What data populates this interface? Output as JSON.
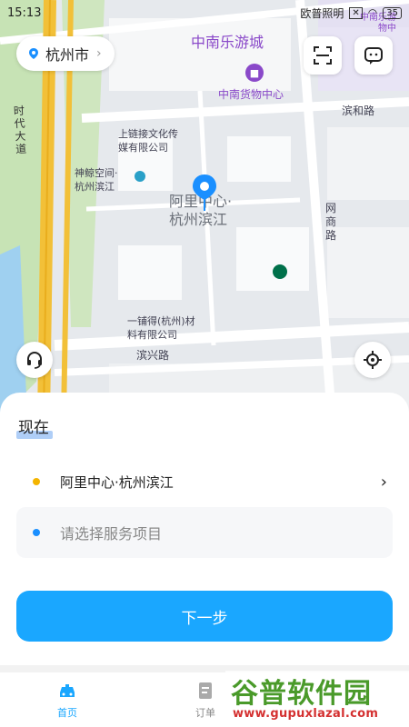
{
  "status_bar": {
    "time": "15:13",
    "carrier": "欧普照明",
    "battery": "35"
  },
  "map": {
    "labels": {
      "district_top": "中南乐游城",
      "mall": "中南货物中心",
      "road_binhe": "滨和路",
      "company1_line1": "上链接文化传",
      "company1_line2": "媒有限公司",
      "space_line1": "神鲸空间·",
      "space_line2": "杭州滨江",
      "current_line1": "阿里中心·",
      "current_line2": "杭州滨江",
      "road_wangshang": "网商路",
      "road_shidai": "时代大道",
      "company2_line1": "一铺得(杭州)材",
      "company2_line2": "料有限公司",
      "road_binxing": "滨兴路",
      "corner_top_right": "中南乐游",
      "corner_top_right2": "物中"
    },
    "colors": {
      "base": "#e9ecef",
      "block": "#f8f9fa",
      "road": "#ffffff",
      "highway": "#f2c038",
      "green": "#c7e3b5",
      "water": "#9fd0f0",
      "pin": "#1a8fff",
      "label_purple": "#8a49c9"
    }
  },
  "city_selector": {
    "label": "杭州市"
  },
  "panel": {
    "time_label": "现在",
    "from_location": "阿里中心·杭州滨江",
    "to_placeholder": "请选择服务项目",
    "next_button": "下一步",
    "from_dot_color": "#f4b400",
    "to_dot_color": "#1a8fff"
  },
  "tabs": [
    {
      "label": "首页",
      "active": true
    },
    {
      "label": "订单",
      "active": false
    }
  ],
  "watermark": {
    "title": "谷普软件园",
    "url": "www.gupuxlazal.com"
  }
}
